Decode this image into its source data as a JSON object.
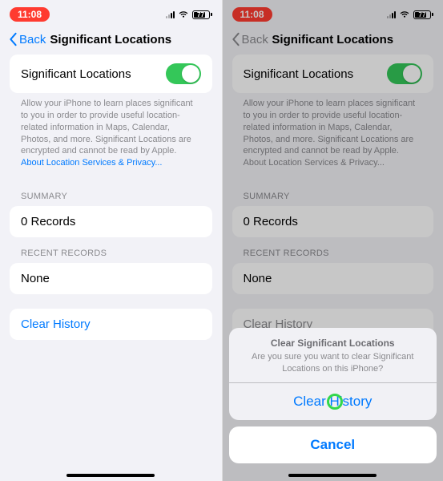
{
  "statusbar": {
    "time": "11:08",
    "battery_pct": "77"
  },
  "nav": {
    "back": "Back",
    "title": "Significant Locations"
  },
  "toggle_row": {
    "label": "Significant Locations"
  },
  "explainer": {
    "text": "Allow your iPhone to learn places significant to you in order to provide useful location-related information in Maps, Calendar, Photos, and more. Significant Locations are encrypted and cannot be read by Apple.",
    "link": "About Location Services & Privacy..."
  },
  "sections": {
    "summary_header": "SUMMARY",
    "summary_value": "0 Records",
    "recent_header": "RECENT RECORDS",
    "recent_value": "None"
  },
  "clear_button": "Clear History",
  "sheet": {
    "title": "Clear Significant Locations",
    "message": "Are you sure you want to clear Significant Locations on this iPhone?",
    "confirm": "Clear History",
    "cancel": "Cancel"
  }
}
